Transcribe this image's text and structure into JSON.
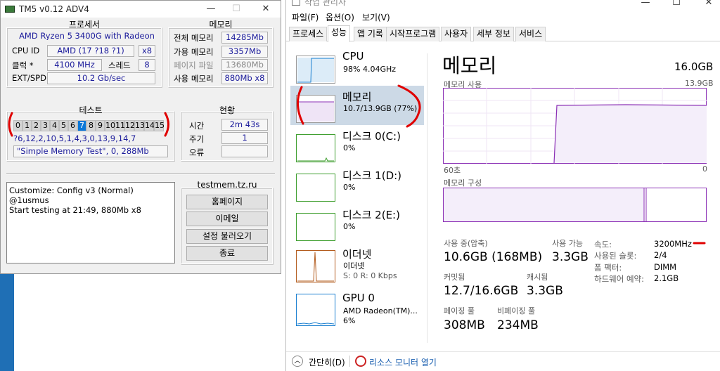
{
  "tm5": {
    "title": "TM5 v0.12 ADV4",
    "processor": {
      "header": "프로세서",
      "name_line": "AMD Ryzen 5 3400G with Radeon",
      "cpu_id_label": "CPU ID",
      "cpu_id_value": "AMD  (17 ?18 ?1)",
      "cpu_id_extra": "x8",
      "clock_label": "클럭 *",
      "clock_value": "4100 MHz",
      "threads_label": "스레드",
      "threads_value": "8",
      "ext_label": "EXT/SPD",
      "ext_value": "10.2 Gb/sec"
    },
    "memory": {
      "header": "메모리",
      "total_label": "전체 메모리",
      "total_value": "14285Mb",
      "avail_label": "가용 메모리",
      "avail_value": "3357Mb",
      "page_label": "페이지 파일",
      "page_value": "13680Mb",
      "used_label": "사용 메모리",
      "used_value": "880Mb x8"
    },
    "test": {
      "header": "테스트",
      "cells": [
        "0",
        "1",
        "2",
        "3",
        "4",
        "5",
        "6",
        "7",
        "8",
        "9",
        "10",
        "11",
        "12",
        "13",
        "14",
        "15"
      ],
      "active_cell": "7",
      "sequence": "?6,12,2,10,5,1,4,3,0,13,9,14,7",
      "config": "\"Simple Memory Test\", 0, 288Mb"
    },
    "status": {
      "header": "현황",
      "time_label": "시간",
      "time_value": "2m 43s",
      "cycle_label": "주기",
      "cycle_value": "1",
      "error_label": "오류",
      "error_value": ""
    },
    "log": {
      "line1": "Customize: Config v3 (Normal) @1usmus",
      "line2": "Start testing at 21:49, 880Mb x8"
    },
    "site": "testmem.tz.ru",
    "buttons": {
      "home": "홈페이지",
      "email": "이메일",
      "load": "설정 불러오기",
      "exit": "종료"
    },
    "title_buttons": {
      "min": "—",
      "max": "☐",
      "close": "✕"
    }
  },
  "taskmgr": {
    "title": "작업 관리자",
    "menu": [
      "파일(F)",
      "옵션(O)",
      "보기(V)"
    ],
    "tabs": [
      "프로세스",
      "성능",
      "앱 기록",
      "시작프로그램",
      "사용자",
      "세부 정보",
      "서비스"
    ],
    "selected_tab": "성능",
    "sidebar": [
      {
        "name": "CPU",
        "sub1": "98% 4.04GHz",
        "sub2": "",
        "color": "#1a7fd0"
      },
      {
        "name": "메모리",
        "sub1": "10.7/13.9GB (77%)",
        "sub2": "",
        "color": "#8b2fb5"
      },
      {
        "name": "디스크 0(C:)",
        "sub1": "0%",
        "sub2": "",
        "color": "#3e9e2e"
      },
      {
        "name": "디스크 1(D:)",
        "sub1": "0%",
        "sub2": "",
        "color": "#3e9e2e"
      },
      {
        "name": "디스크 2(E:)",
        "sub1": "0%",
        "sub2": "",
        "color": "#3e9e2e"
      },
      {
        "name": "이더넷",
        "sub1": "이더넷",
        "sub2": "S: 0 R: 0 Kbps",
        "color": "#b35c1e"
      },
      {
        "name": "GPU 0",
        "sub1": "AMD Radeon(TM)...",
        "sub2": "6%",
        "color": "#1a7fd0"
      }
    ],
    "panel": {
      "title": "메모리",
      "total": "16.0GB",
      "usage_label": "메모리 사용",
      "usage_max": "13.9GB",
      "time_left": "60초",
      "time_right": "0",
      "composition_label": "메모리 구성",
      "in_use_label": "사용 중(압축)",
      "in_use_value": "10.6GB (168MB)",
      "available_label": "사용 가능",
      "available_value": "3.3GB",
      "committed_label": "커밋됨",
      "committed_value": "12.7/16.6GB",
      "cached_label": "캐시됨",
      "cached_value": "3.3GB",
      "paged_label": "페이징 풀",
      "paged_value": "308MB",
      "nonpaged_label": "비페이징 풀",
      "nonpaged_value": "234MB",
      "speed_label": "속도:",
      "speed_value": "3200MHz",
      "slots_label": "사용된 슬롯:",
      "slots_value": "2/4",
      "form_label": "폼 팩터:",
      "form_value": "DIMM",
      "reserved_label": "하드웨어 예약:",
      "reserved_value": "2.1GB"
    },
    "footer": {
      "collapse": "간단히(D)",
      "resource_monitor": "리소스 모니터 열기"
    },
    "title_buttons": {
      "min": "—",
      "max": "☐",
      "close": "✕"
    }
  },
  "colors": {
    "memory_line": "#8b2fb5",
    "memory_fill": "#f4eefa",
    "selection": "#ccd9e6",
    "annotation_red": "#e00000",
    "tm5_active_cell": "#0a77d8",
    "tm5_value_text": "#1b1b9b"
  }
}
